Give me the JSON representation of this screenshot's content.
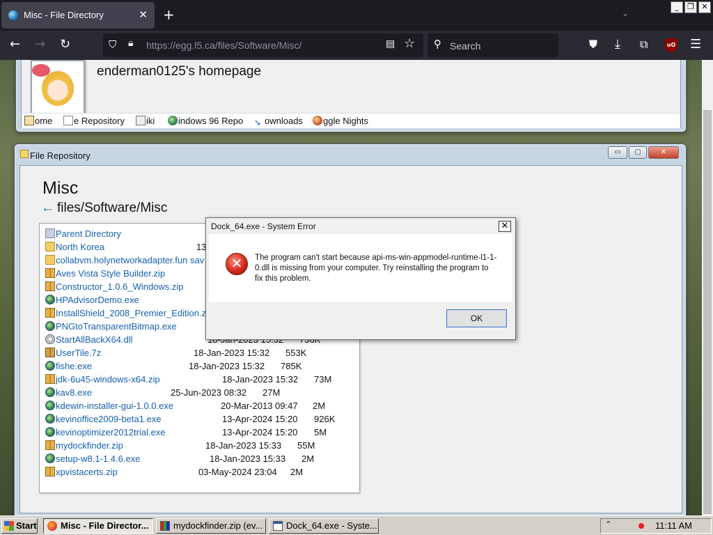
{
  "browser": {
    "tab_title": "Misc - File Directory",
    "tab_close": "✕",
    "new_tab": "+",
    "url": "https://egg.l5.ca/files/Software/Misc/",
    "search_placeholder": "Search",
    "window_controls": [
      "_",
      "❐",
      "✕"
    ],
    "ublock_label": "uO"
  },
  "site": {
    "title": "enderman0125's homepage",
    "nav": [
      {
        "label": "ome",
        "icon": "home-icon"
      },
      {
        "label": "e Repository",
        "icon": "file-icon"
      },
      {
        "label": "iki",
        "icon": "book-icon"
      },
      {
        "label": "indows 96 Repo",
        "icon": "globe-icon"
      },
      {
        "label": "ownloads",
        "icon": "download-icon"
      },
      {
        "label": "ggle Nights",
        "icon": "globe-icon"
      }
    ]
  },
  "repo_window": {
    "title": "File Repository",
    "controls": [
      "▭",
      "▢",
      "✕"
    ],
    "heading": "Misc",
    "back_arrow": "←",
    "path": "files/Software/Misc",
    "files": [
      {
        "name": "Parent Directory",
        "icon": "parent",
        "date": "",
        "size": ""
      },
      {
        "name": "North Korea",
        "icon": "folder",
        "date": "13",
        "size": ""
      },
      {
        "name": "collabvm.holynetworkadapter.fun sav",
        "icon": "folder",
        "date": "",
        "size": ""
      },
      {
        "name": "Aves Vista Style Builder.zip",
        "icon": "zip",
        "date": "",
        "size": ""
      },
      {
        "name": "Constructor_1.0.6_Windows.zip",
        "icon": "zip",
        "date": "",
        "size": ""
      },
      {
        "name": "HPAdvisorDemo.exe",
        "icon": "exe",
        "date": "",
        "size": ""
      },
      {
        "name": "InstallShield_2008_Premier_Edition.zi",
        "icon": "zip",
        "date": "",
        "size": ""
      },
      {
        "name": "PNGtoTransparentBitmap.exe",
        "icon": "exe",
        "date": "",
        "size": ""
      },
      {
        "name": "StartAllBackX64.dll",
        "icon": "dll",
        "date": "18-Jan-2023 15:32",
        "size": "736K"
      },
      {
        "name": "UserTile.7z",
        "icon": "seven",
        "date": "18-Jan-2023 15:32",
        "size": "553K"
      },
      {
        "name": "fishe.exe",
        "icon": "exe",
        "date": "18-Jan-2023 15:32",
        "size": "785K"
      },
      {
        "name": "jdk-6u45-windows-x64.zip",
        "icon": "zip",
        "date": "18-Jan-2023 15:32",
        "size": "73M"
      },
      {
        "name": "kav8.exe",
        "icon": "exe",
        "date": "25-Jun-2023 08:32",
        "size": "27M"
      },
      {
        "name": "kdewin-installer-gui-1.0.0.exe",
        "icon": "exe",
        "date": "20-Mar-2013 09:47",
        "size": "2M"
      },
      {
        "name": "kevinoffice2009-beta1.exe",
        "icon": "exe",
        "date": "13-Apr-2024 15:20",
        "size": "926K"
      },
      {
        "name": "kevinoptimizer2012trial.exe",
        "icon": "exe",
        "date": "13-Apr-2024 15:20",
        "size": "5M"
      },
      {
        "name": "mydockfinder.zip",
        "icon": "zip",
        "date": "18-Jan-2023 15:33",
        "size": "55M"
      },
      {
        "name": "setup-w8.1-1.4.6.exe",
        "icon": "exe",
        "date": "18-Jan-2023 15:33",
        "size": "2M"
      },
      {
        "name": "xpvistacerts.zip",
        "icon": "zip",
        "date": "03-May-2024 23:04",
        "size": "2M"
      }
    ]
  },
  "dialog": {
    "title": "Dock_64.exe - System Error",
    "close": "✕",
    "icon": "error-icon",
    "message": "The program can't start because api-ms-win-appmodel-runtime-l1-1-0.dll is missing from your computer. Try reinstalling the program to fix this problem.",
    "ok_label": "OK"
  },
  "taskbar": {
    "start_label": "Start",
    "tasks": [
      {
        "label": "Misc - File Director...",
        "active": true
      },
      {
        "label": "mydockfinder.zip (ev...",
        "active": false
      },
      {
        "label": "Dock_64.exe - Syste...",
        "active": false
      }
    ],
    "tray_arrow": "⌃",
    "clock": "11:11 AM"
  }
}
